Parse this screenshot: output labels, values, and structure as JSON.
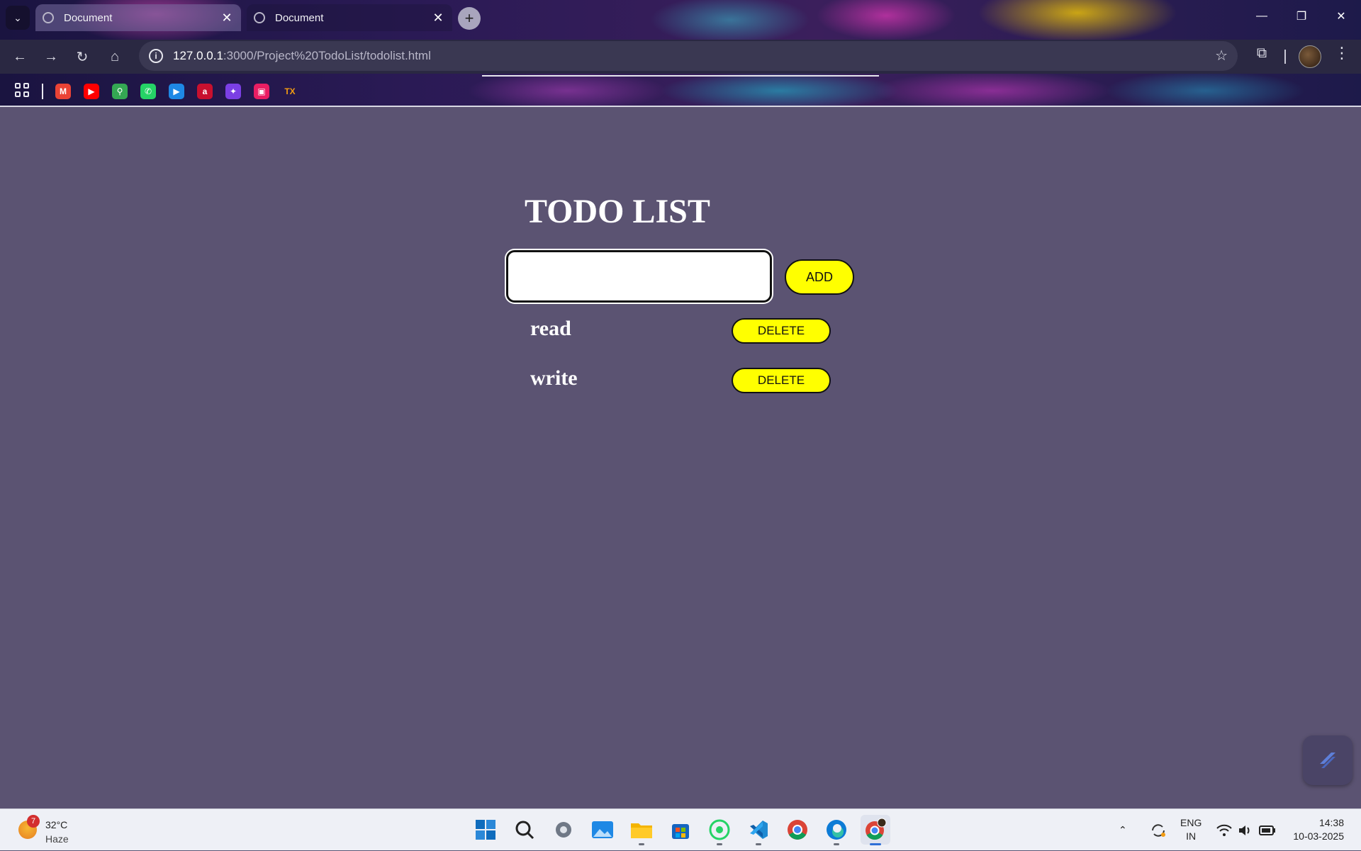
{
  "browser": {
    "tabs": [
      {
        "title": "Document",
        "active": false
      },
      {
        "title": "Document",
        "active": true
      }
    ],
    "address": {
      "host": "127.0.0.1",
      "rest": ":3000/Project%20TodoList/todolist.html"
    },
    "bookmarks": [
      {
        "name": "gmail-bookmark",
        "glyph": "M",
        "color": "#ea4335"
      },
      {
        "name": "youtube-bookmark",
        "glyph": "▶",
        "color": "#ff0000"
      },
      {
        "name": "maps-bookmark",
        "glyph": "⚲",
        "color": "#34a853"
      },
      {
        "name": "whatsapp-bookmark",
        "glyph": "✆",
        "color": "#25d366"
      },
      {
        "name": "player-bookmark",
        "glyph": "▶",
        "color": "#1e88e5"
      },
      {
        "name": "airtel-bookmark",
        "glyph": "a",
        "color": "#c8102e"
      },
      {
        "name": "app-bookmark",
        "glyph": "✦",
        "color": "#7b3fe4"
      },
      {
        "name": "calendar-bookmark",
        "glyph": "▣",
        "color": "#e91e63"
      },
      {
        "name": "tx-bookmark",
        "glyph": "TX",
        "color": "#f39c12"
      }
    ]
  },
  "app": {
    "title": "TODO LIST",
    "input_value": "",
    "add_label": "ADD",
    "tasks": [
      {
        "text": "read",
        "delete_label": "DELETE"
      },
      {
        "text": "write",
        "delete_label": "DELETE"
      }
    ],
    "colors": {
      "background": "#5b5372",
      "button": "#ffff00",
      "text": "#ffffff"
    }
  },
  "taskbar": {
    "weather": {
      "badge": "7",
      "temp": "32°C",
      "condition": "Haze"
    },
    "apps": [
      "start-button",
      "search",
      "settings",
      "photos",
      "file-explorer",
      "microsoft-store",
      "whatsapp",
      "vs-code",
      "chrome",
      "edge",
      "chrome-profile"
    ],
    "language": {
      "line1": "ENG",
      "line2": "IN"
    },
    "time": "14:38",
    "date": "10-03-2025"
  }
}
